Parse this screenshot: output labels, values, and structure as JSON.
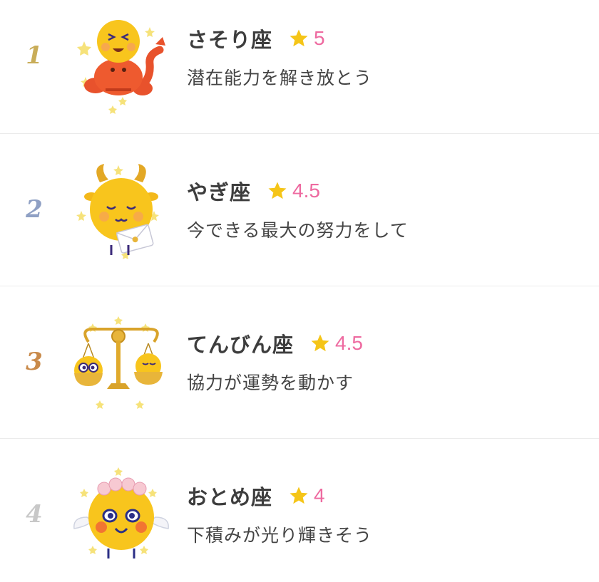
{
  "ranking": [
    {
      "rank": "1",
      "rank_color": "#c9ad59",
      "sign": "さそり座",
      "score": "5",
      "message": "潜在能力を解き放とう",
      "mascot_icon": "scorpio-mascot-icon"
    },
    {
      "rank": "2",
      "rank_color": "#8fa0c4",
      "sign": "やぎ座",
      "score": "4.5",
      "message": "今できる最大の努力をして",
      "mascot_icon": "capricorn-mascot-icon"
    },
    {
      "rank": "3",
      "rank_color": "#c98a4a",
      "sign": "てんびん座",
      "score": "4.5",
      "message": "協力が運勢を動かす",
      "mascot_icon": "libra-mascot-icon"
    },
    {
      "rank": "4",
      "rank_color": "#c8c8c8",
      "sign": "おとめ座",
      "score": "4",
      "message": "下積みが光り輝きそう",
      "mascot_icon": "virgo-mascot-icon"
    }
  ],
  "colors": {
    "score_pink": "#ee6aa0",
    "star_gold": "#f5c518",
    "text_dark": "#3d3d3d",
    "divider": "#ebebeb"
  }
}
